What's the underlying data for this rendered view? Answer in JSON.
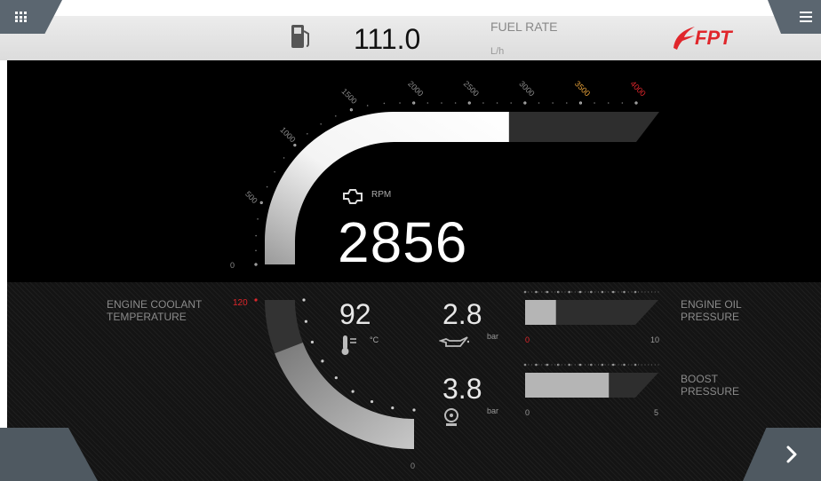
{
  "header": {
    "fuel_value": "111.0",
    "fuel_label": "FUEL RATE",
    "fuel_unit": "L/h",
    "brand": "FPT",
    "menu_left_icon": "grid-menu-icon",
    "menu_right_icon": "list-menu-icon",
    "fuel_icon": "fuel-pump-icon"
  },
  "rpm": {
    "label": "RPM",
    "value": "2856",
    "icon": "engine-icon",
    "ticks": [
      "0",
      "500",
      "1000",
      "1500",
      "2000",
      "2500",
      "3000",
      "3500",
      "4000"
    ],
    "max": 4000,
    "current": 2856
  },
  "coolant": {
    "label_line1": "ENGINE COOLANT",
    "label_line2": "TEMPERATURE",
    "value": "92",
    "unit": "°C",
    "max_label": "120",
    "min_label": "0",
    "icon": "thermometer-icon",
    "max": 120,
    "current": 92
  },
  "oil": {
    "label_line1": "ENGINE OIL",
    "label_line2": "PRESSURE",
    "value": "2.8",
    "unit": "bar",
    "min_label": "0",
    "max_label": "10",
    "icon": "oil-can-icon",
    "max": 10,
    "current": 2.8
  },
  "boost": {
    "label_line1": "BOOST",
    "label_line2": "PRESSURE",
    "value": "3.8",
    "unit": "bar",
    "min_label": "0",
    "max_label": "5",
    "icon": "turbo-icon",
    "max": 5,
    "current": 3.8
  },
  "nav": {
    "next_icon": "chevron-right-icon"
  },
  "colors": {
    "accent_red": "#e0262b",
    "warn_orange": "#e8a23a",
    "gauge_white": "#f2f2f2",
    "gauge_dark": "#3a3a3a"
  }
}
